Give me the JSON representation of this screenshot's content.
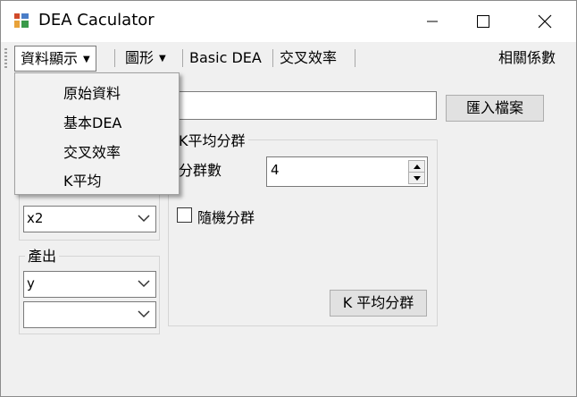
{
  "window": {
    "title": "DEA Caculator"
  },
  "menu": {
    "data_view": "資料顯示",
    "chart": "圖形",
    "basic_dea": "Basic DEA",
    "cross_eff": "交叉效率",
    "correlation": "相關係數",
    "dropdown": [
      "原始資料",
      "基本DEA",
      "交叉效率",
      "K平均"
    ]
  },
  "import_button": "匯入檔案",
  "input_combos": [
    "x2"
  ],
  "output_group": {
    "label": "產出",
    "combos": [
      "y",
      ""
    ]
  },
  "kmeans_group": {
    "label": "K平均分群",
    "count_label": "分群數",
    "count_value": "4",
    "random_label": "隨機分群",
    "random_checked": false,
    "run_button": "K 平均分群"
  }
}
